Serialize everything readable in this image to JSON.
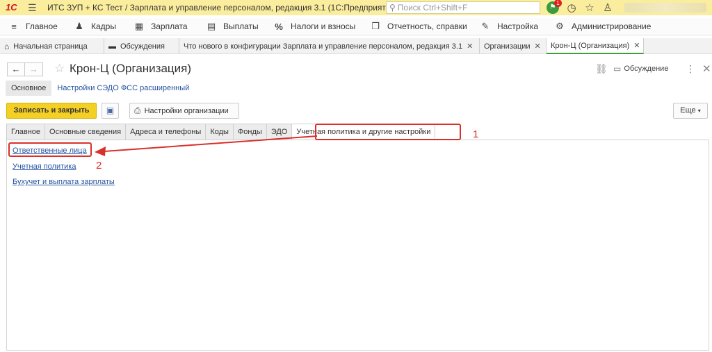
{
  "titlebar": {
    "logo": "1С",
    "title": "ИТС ЗУП + КС Тест / Зарплата и управление персоналом, редакция 3.1  (1С:Предприятие)",
    "search_placeholder": "Поиск Ctrl+Shift+F",
    "notification_count": "1"
  },
  "main_menu": [
    {
      "label": "Главное",
      "icon": "menu-lines-icon"
    },
    {
      "label": "Кадры",
      "icon": "people-icon"
    },
    {
      "label": "Зарплата",
      "icon": "calculator-icon"
    },
    {
      "label": "Выплаты",
      "icon": "cash-icon"
    },
    {
      "label": "Налоги и взносы",
      "icon": "percent-icon"
    },
    {
      "label": "Отчетность, справки",
      "icon": "reports-icon"
    },
    {
      "label": "Настройка",
      "icon": "wrench-icon"
    },
    {
      "label": "Администрирование",
      "icon": "gear-icon"
    }
  ],
  "open_tabs": [
    {
      "label": "Начальная страница"
    },
    {
      "label": "Обсуждения"
    },
    {
      "label": "Что нового в конфигурации Зарплата и управление персоналом, редакция 3.1"
    },
    {
      "label": "Организации"
    },
    {
      "label": "Крон-Ц (Организация)"
    }
  ],
  "form": {
    "title": "Крон-Ц (Организация)",
    "discussion_label": "Обсуждение",
    "subsections": {
      "main": "Основное",
      "link": "Настройки СЭДО ФСС расширенный"
    },
    "commands": {
      "save_close": "Записать и закрыть",
      "org_settings": "Настройки организации",
      "more": "Еще"
    },
    "tabs": [
      {
        "label": "Главное"
      },
      {
        "label": "Основные сведения"
      },
      {
        "label": "Адреса и телефоны"
      },
      {
        "label": "Коды"
      },
      {
        "label": "Фонды"
      },
      {
        "label": "ЭДО"
      },
      {
        "label": "Учетная политика и другие настройки"
      }
    ],
    "links": [
      {
        "label": "Ответственные лица"
      },
      {
        "label": "Учетная политика"
      },
      {
        "label": "Бухучет и выплата зарплаты"
      }
    ]
  },
  "annotations": {
    "marker_1": "1",
    "marker_2": "2",
    "color": "#d9302c"
  },
  "colors": {
    "titlebar": "#fbed9e",
    "primary_button": "#f4d024",
    "link": "#2353a0",
    "active_tab_underline": "#3a9c3a"
  }
}
